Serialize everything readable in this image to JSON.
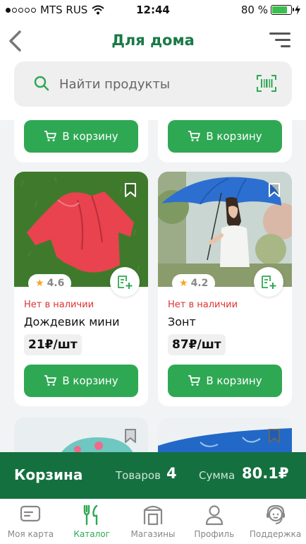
{
  "status_bar": {
    "carrier": "MTS RUS",
    "time": "12:44",
    "battery": "80 %",
    "battery_level": 0.8
  },
  "header": {
    "title": "Для дома"
  },
  "search": {
    "placeholder": "Найти продукты"
  },
  "top_row": {
    "left_button": "В корзину",
    "right_button": "В корзину"
  },
  "products": [
    {
      "name": "Дождевик мини",
      "rating": "4.6",
      "stock": "Нет в наличии",
      "price": "21₽/шт",
      "button": "В корзину"
    },
    {
      "name": "Зонт",
      "rating": "4.2",
      "stock": "Нет в наличии",
      "price": "87₽/шт",
      "button": "В корзину"
    }
  ],
  "cart": {
    "title": "Корзина",
    "items_label": "Товаров",
    "items_count": "4",
    "sum_label": "Сумма",
    "sum_value": "80.1₽"
  },
  "colors": {
    "accent": "#2fa854",
    "brand_dark": "#14703f",
    "title": "#197a47",
    "out_of_stock": "#dd3333"
  },
  "tabs": [
    {
      "label": "Моя карта",
      "icon": "card-icon"
    },
    {
      "label": "Каталог",
      "icon": "catalog-icon",
      "active": true
    },
    {
      "label": "Магазины",
      "icon": "store-icon"
    },
    {
      "label": "Профиль",
      "icon": "profile-icon"
    },
    {
      "label": "Поддержка",
      "icon": "support-icon"
    }
  ]
}
